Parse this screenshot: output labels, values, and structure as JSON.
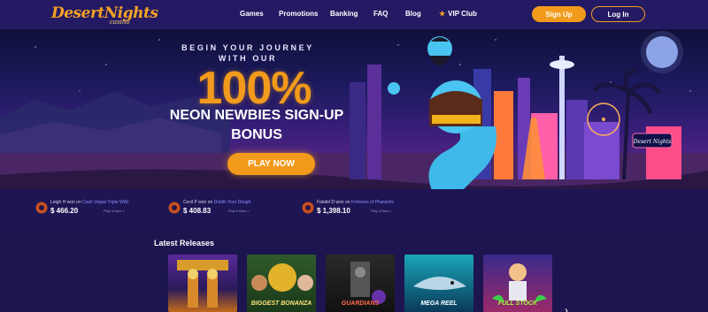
{
  "brand": {
    "logo": "DesertNights",
    "logo_sub": "casino"
  },
  "nav": [
    {
      "label": "Games"
    },
    {
      "label": "Promotions"
    },
    {
      "label": "Banking"
    },
    {
      "label": "FAQ"
    },
    {
      "label": "Blog"
    },
    {
      "label": "VIP Club"
    }
  ],
  "auth": {
    "signup": "Sign Up",
    "login": "Log In"
  },
  "hero": {
    "eyebrow1": "BEGIN YOUR JOURNEY",
    "eyebrow2": "WITH OUR",
    "big": "100%",
    "sub1": "NEON NEWBIES SIGN-UP",
    "sub2": "BONUS",
    "cta": "PLAY NOW",
    "sign": "Desert Nights"
  },
  "winners": [
    {
      "name": "Leigh H",
      "won_on": "won on",
      "game": "Cash Vegas Triple Wild",
      "amount": "$ 466.20",
      "link": "Play it Now >"
    },
    {
      "name": "Cecil P",
      "won_on": "won on",
      "game": "Dublin Your Dough",
      "amount": "$ 408.83",
      "link": "Play it Now >"
    },
    {
      "name": "Falafel D",
      "won_on": "won on",
      "game": "Fortunes of Pharaohs",
      "amount": "$ 1,398.10",
      "link": "Play it Now >"
    }
  ],
  "latest": {
    "title": "Latest Releases",
    "games": [
      {
        "label": ""
      },
      {
        "label": "BIGGEST BONANZA"
      },
      {
        "label": "GUARDIANS"
      },
      {
        "label": "MEGA REEL"
      },
      {
        "label": "FULL STOCK"
      }
    ]
  },
  "colors": {
    "accent": "#f29a1b",
    "bg": "#1c1550",
    "header": "#241a63"
  },
  "icons": [
    "star-icon",
    "chip-icon",
    "chevron-right-icon"
  ]
}
